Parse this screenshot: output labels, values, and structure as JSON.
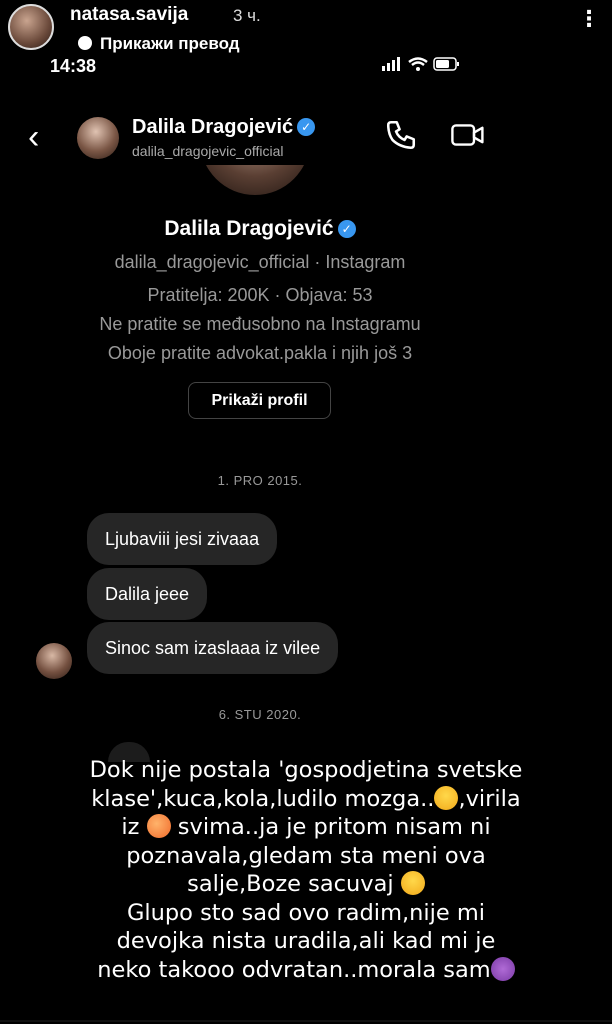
{
  "story": {
    "username": "natasa.savija",
    "time": "3 ч.",
    "more": "⋮",
    "translate_label": "Прикажи превод"
  },
  "status_bar": {
    "clock": "14:38"
  },
  "chat_header": {
    "back": "‹",
    "name": "Dalila Dragojević",
    "handle": "dalila_dragojevic_official"
  },
  "profile_card": {
    "name": "Dalila Dragojević",
    "handle_line": "dalila_dragojevic_official · Instagram",
    "stats": "Pratitelja: 200K · Objava: 53",
    "follow_note": "Ne pratite se međusobno na Instagramu",
    "mutual": "Oboje pratite advokat.pakla i njih još 3",
    "button": "Prikaži profil"
  },
  "messages": {
    "date1": "1. PRO 2015.",
    "items": [
      "Ljubaviii jesi zivaaa",
      "Dalila jeee",
      "Sinoc sam izaslaaa iz vilee"
    ],
    "date2": "6. STU 2020."
  },
  "caption": {
    "l1": "Dok nije postala 'gospodjetina svetske",
    "l2": "klase',kuca,kola,ludilo mozga..",
    "l2b": ",virila",
    "l3a": "iz ",
    "l3b": " svima..ja je pritom nisam ni",
    "l4": "poznavala,gledam sta meni ova",
    "l5": "salje,Boze sacuvaj ",
    "l6": "Glupo sto sad ovo radim,nije mi",
    "l7": "devojka nista uradila,ali kad mi je",
    "l8": "neko takooo odvratan..morala sam"
  },
  "icons": {
    "verified": "verified-badge",
    "phone": "phone-icon",
    "video": "video-camera-icon",
    "emoji_laugh": "tears-of-joy-emoji",
    "emoji_peach": "peach-emoji",
    "emoji_devil": "smiling-devil-emoji"
  }
}
